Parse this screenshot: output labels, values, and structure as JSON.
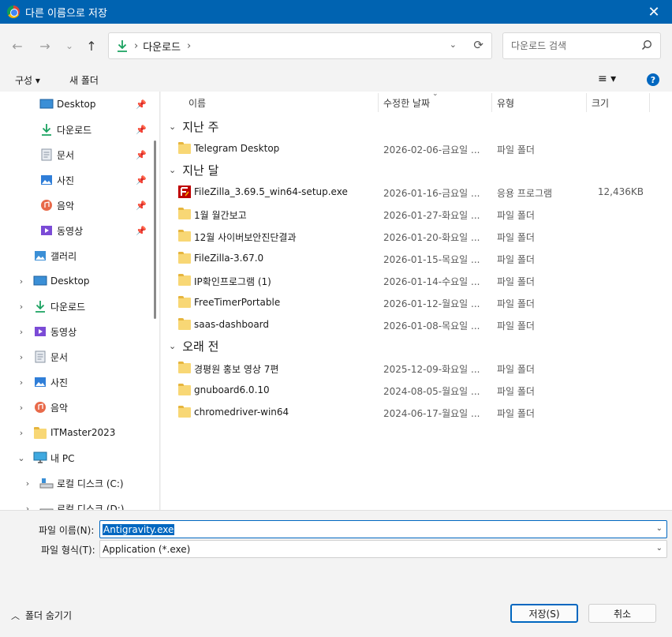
{
  "window": {
    "title": "다른 이름으로 저장",
    "close_label": "✕"
  },
  "nav": {
    "back": "←",
    "forward": "→",
    "recent": "⌄",
    "up": "↑",
    "breadcrumb": [
      "다운로드"
    ],
    "search_placeholder": "다운로드 검색"
  },
  "toolbar": {
    "organize": "구성 ▾",
    "new_folder": "새 폴더",
    "view": "≡ ▾",
    "help": "?"
  },
  "sidebar": {
    "quick_access": [
      {
        "label": "Desktop",
        "icon": "desktop-icon"
      },
      {
        "label": "다운로드",
        "icon": "download-icon"
      },
      {
        "label": "문서",
        "icon": "document-icon"
      },
      {
        "label": "사진",
        "icon": "pictures-icon"
      },
      {
        "label": "음악",
        "icon": "music-icon"
      },
      {
        "label": "동영상",
        "icon": "video-icon"
      }
    ],
    "gallery": "갤러리",
    "tree": [
      {
        "label": "Desktop",
        "icon": "desktop-icon"
      },
      {
        "label": "다운로드",
        "icon": "download-icon"
      },
      {
        "label": "동영상",
        "icon": "video-icon"
      },
      {
        "label": "문서",
        "icon": "document-icon"
      },
      {
        "label": "사진",
        "icon": "pictures-icon"
      },
      {
        "label": "음악",
        "icon": "music-icon"
      },
      {
        "label": "ITMaster2023",
        "icon": "folder-icon"
      }
    ],
    "this_pc": "내 PC",
    "drives": [
      "로컬 디스크 (C:)",
      "로컬 디스크 (D:)"
    ]
  },
  "columns": {
    "name": "이름",
    "date": "수정한 날짜",
    "type": "유형",
    "size": "크기"
  },
  "groups": [
    {
      "label": "지난 주",
      "rows": [
        {
          "name": "Telegram Desktop",
          "date": "2026-02-06-금요일 ...",
          "type": "파일 폴더",
          "size": "",
          "icon": "folder"
        }
      ]
    },
    {
      "label": "지난 달",
      "rows": [
        {
          "name": "FileZilla_3.69.5_win64-setup.exe",
          "date": "2026-01-16-금요일 ...",
          "type": "응용 프로그램",
          "size": "12,436KB",
          "icon": "filezilla"
        },
        {
          "name": "1월 월간보고",
          "date": "2026-01-27-화요일 ...",
          "type": "파일 폴더",
          "size": "",
          "icon": "folder"
        },
        {
          "name": "12월 사이버보안진단결과",
          "date": "2026-01-20-화요일 ...",
          "type": "파일 폴더",
          "size": "",
          "icon": "folder"
        },
        {
          "name": "FileZilla-3.67.0",
          "date": "2026-01-15-목요일 ...",
          "type": "파일 폴더",
          "size": "",
          "icon": "folder"
        },
        {
          "name": "IP확인프로그램 (1)",
          "date": "2026-01-14-수요일 ...",
          "type": "파일 폴더",
          "size": "",
          "icon": "folder"
        },
        {
          "name": "FreeTimerPortable",
          "date": "2026-01-12-월요일 ...",
          "type": "파일 폴더",
          "size": "",
          "icon": "folder"
        },
        {
          "name": "saas-dashboard",
          "date": "2026-01-08-목요일 ...",
          "type": "파일 폴더",
          "size": "",
          "icon": "folder"
        }
      ]
    },
    {
      "label": "오래 전",
      "rows": [
        {
          "name": "경평원 홍보 영상 7편",
          "date": "2025-12-09-화요일 ...",
          "type": "파일 폴더",
          "size": "",
          "icon": "folder"
        },
        {
          "name": "gnuboard6.0.10",
          "date": "2024-08-05-월요일 ...",
          "type": "파일 폴더",
          "size": "",
          "icon": "folder"
        },
        {
          "name": "chromedriver-win64",
          "date": "2024-06-17-월요일 ...",
          "type": "파일 폴더",
          "size": "",
          "icon": "folder"
        }
      ]
    }
  ],
  "form": {
    "filename_label": "파일 이름(N):",
    "filename_value": "Antigravity.exe",
    "filetype_label": "파일 형식(T):",
    "filetype_value": "Application (*.exe)"
  },
  "footer": {
    "hide_folders": "폴더 숨기기",
    "save": "저장(S)",
    "cancel": "취소"
  },
  "colors": {
    "titlebar": "#0063b1",
    "accent": "#0067c0",
    "folder": "#f8d775"
  }
}
